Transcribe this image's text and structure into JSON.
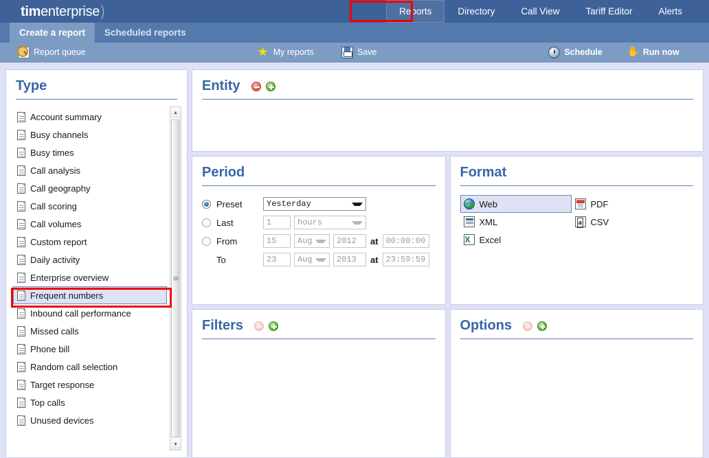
{
  "brand": {
    "bold": "tim",
    "regular": "enterprise",
    "swoosh": ")"
  },
  "topnav": {
    "items": [
      {
        "label": "Reports",
        "active": true
      },
      {
        "label": "Directory",
        "active": false
      },
      {
        "label": "Call View",
        "active": false
      },
      {
        "label": "Tariff Editor",
        "active": false
      },
      {
        "label": "Alerts",
        "active": false
      }
    ]
  },
  "tabs": [
    {
      "label": "Create a report",
      "active": true
    },
    {
      "label": "Scheduled reports",
      "active": false
    }
  ],
  "toolbar": {
    "report_queue": "Report queue",
    "my_reports": "My reports",
    "save": "Save",
    "schedule": "Schedule",
    "run_now": "Run now",
    "run_glyph": "↯"
  },
  "type_panel": {
    "title": "Type",
    "selected": "Frequent numbers",
    "items": [
      "Account summary",
      "Busy channels",
      "Busy times",
      "Call analysis",
      "Call geography",
      "Call scoring",
      "Call volumes",
      "Custom report",
      "Daily activity",
      "Enterprise overview",
      "Frequent numbers",
      "Inbound call performance",
      "Missed calls",
      "Phone bill",
      "Random call selection",
      "Target response",
      "Top calls",
      "Unused devices"
    ]
  },
  "entity_panel": {
    "title": "Entity",
    "minus_enabled": true,
    "plus_enabled": true
  },
  "period_panel": {
    "title": "Period",
    "selected_mode": "Preset",
    "preset": {
      "label": "Preset",
      "value": "Yesterday"
    },
    "last": {
      "label": "Last",
      "amount": "1",
      "unit": "hours"
    },
    "from": {
      "label": "From",
      "day": "15",
      "month": "Aug",
      "year": "2012",
      "at": "at",
      "time": "00:00:00"
    },
    "to": {
      "label": "To",
      "day": "23",
      "month": "Aug",
      "year": "2013",
      "at": "at",
      "time": "23:59:59"
    }
  },
  "format_panel": {
    "title": "Format",
    "selected": "Web",
    "left_items": [
      {
        "label": "Web",
        "icon": "web-icon"
      },
      {
        "label": "XML",
        "icon": "xml-icon"
      },
      {
        "label": "Excel",
        "icon": "excel-icon"
      }
    ],
    "right_items": [
      {
        "label": "PDF",
        "icon": "pdf-icon"
      },
      {
        "label": "CSV",
        "icon": "csv-icon"
      }
    ]
  },
  "filters_panel": {
    "title": "Filters",
    "minus_enabled": false,
    "plus_enabled": true
  },
  "options_panel": {
    "title": "Options",
    "minus_enabled": false,
    "plus_enabled": true
  },
  "colors": {
    "header_blue": "#3d6198",
    "tab_blue": "#5379ad",
    "toolbar_blue": "#7d9cc4",
    "page_bg": "#dfe1f6",
    "panel_title": "#3766a6",
    "selection_bg": "#dfe2f5",
    "selection_border": "#6f86c0",
    "annotation_red": "#ee0000"
  }
}
